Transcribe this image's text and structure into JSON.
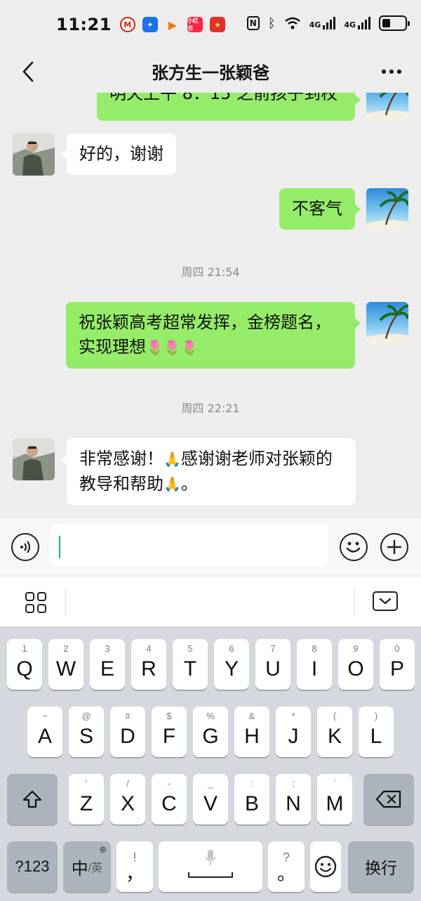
{
  "status_bar": {
    "time": "11:21",
    "notif_icons": [
      "metro-icon",
      "lightbulb-icon",
      "play-icon",
      "xiaohongshu-icon",
      "redenvelope-icon"
    ],
    "net1": "4G",
    "net2": "4G",
    "battery_level": 0.35
  },
  "header": {
    "title": "张方生一张颖爸"
  },
  "chat": {
    "partial_message": "明天上午 8：15 之前孩子到校",
    "messages": [
      {
        "from": "other",
        "text": "好的，谢谢"
      },
      {
        "from": "me",
        "text": "不客气"
      },
      {
        "type": "time",
        "text": "周四 21:54"
      },
      {
        "from": "me",
        "line1": "祝张颖高考超常发挥，金榜题名，",
        "line2": "实现理想",
        "emoji": "🌷🌷🌷"
      },
      {
        "type": "time",
        "text": "周四 22:21"
      },
      {
        "from": "other",
        "line1a": "非常感谢！",
        "emoji1": "🙏",
        "line1b": "感谢谢老师对张颖的",
        "line2a": "教导和帮助",
        "emoji2": "🙏",
        "line2b": "。"
      }
    ]
  },
  "input": {
    "value": ""
  },
  "keyboard": {
    "row1": [
      {
        "hint": "1",
        "key": "Q"
      },
      {
        "hint": "2",
        "key": "W"
      },
      {
        "hint": "3",
        "key": "E"
      },
      {
        "hint": "4",
        "key": "R"
      },
      {
        "hint": "5",
        "key": "T"
      },
      {
        "hint": "6",
        "key": "Y"
      },
      {
        "hint": "7",
        "key": "U"
      },
      {
        "hint": "8",
        "key": "I"
      },
      {
        "hint": "9",
        "key": "O"
      },
      {
        "hint": "0",
        "key": "P"
      }
    ],
    "row2": [
      {
        "hint": "~",
        "key": "A"
      },
      {
        "hint": "@",
        "key": "S"
      },
      {
        "hint": "#",
        "key": "D"
      },
      {
        "hint": "$",
        "key": "F"
      },
      {
        "hint": "%",
        "key": "G"
      },
      {
        "hint": "&",
        "key": "H"
      },
      {
        "hint": "*",
        "key": "J"
      },
      {
        "hint": "(",
        "key": "K"
      },
      {
        "hint": ")",
        "key": "L"
      }
    ],
    "row3": [
      {
        "hint": "'",
        "key": "Z"
      },
      {
        "hint": "/",
        "key": "X"
      },
      {
        "hint": "-",
        "key": "C"
      },
      {
        "hint": "_",
        "key": "V"
      },
      {
        "hint": ":",
        "key": "B"
      },
      {
        "hint": ";",
        "key": "N"
      },
      {
        "hint": "`",
        "key": "M"
      }
    ],
    "row4": {
      "num_label": "?123",
      "lang_main": "中",
      "lang_sub": "/英",
      "comma_hint": "!",
      "comma_key": "，",
      "period_hint": "?",
      "period_key": "。",
      "enter_label": "换行"
    }
  },
  "colors": {
    "my_bubble": "#95ec69",
    "other_bubble": "#ffffff",
    "chat_bg": "#ededed",
    "caret": "#07c160"
  }
}
